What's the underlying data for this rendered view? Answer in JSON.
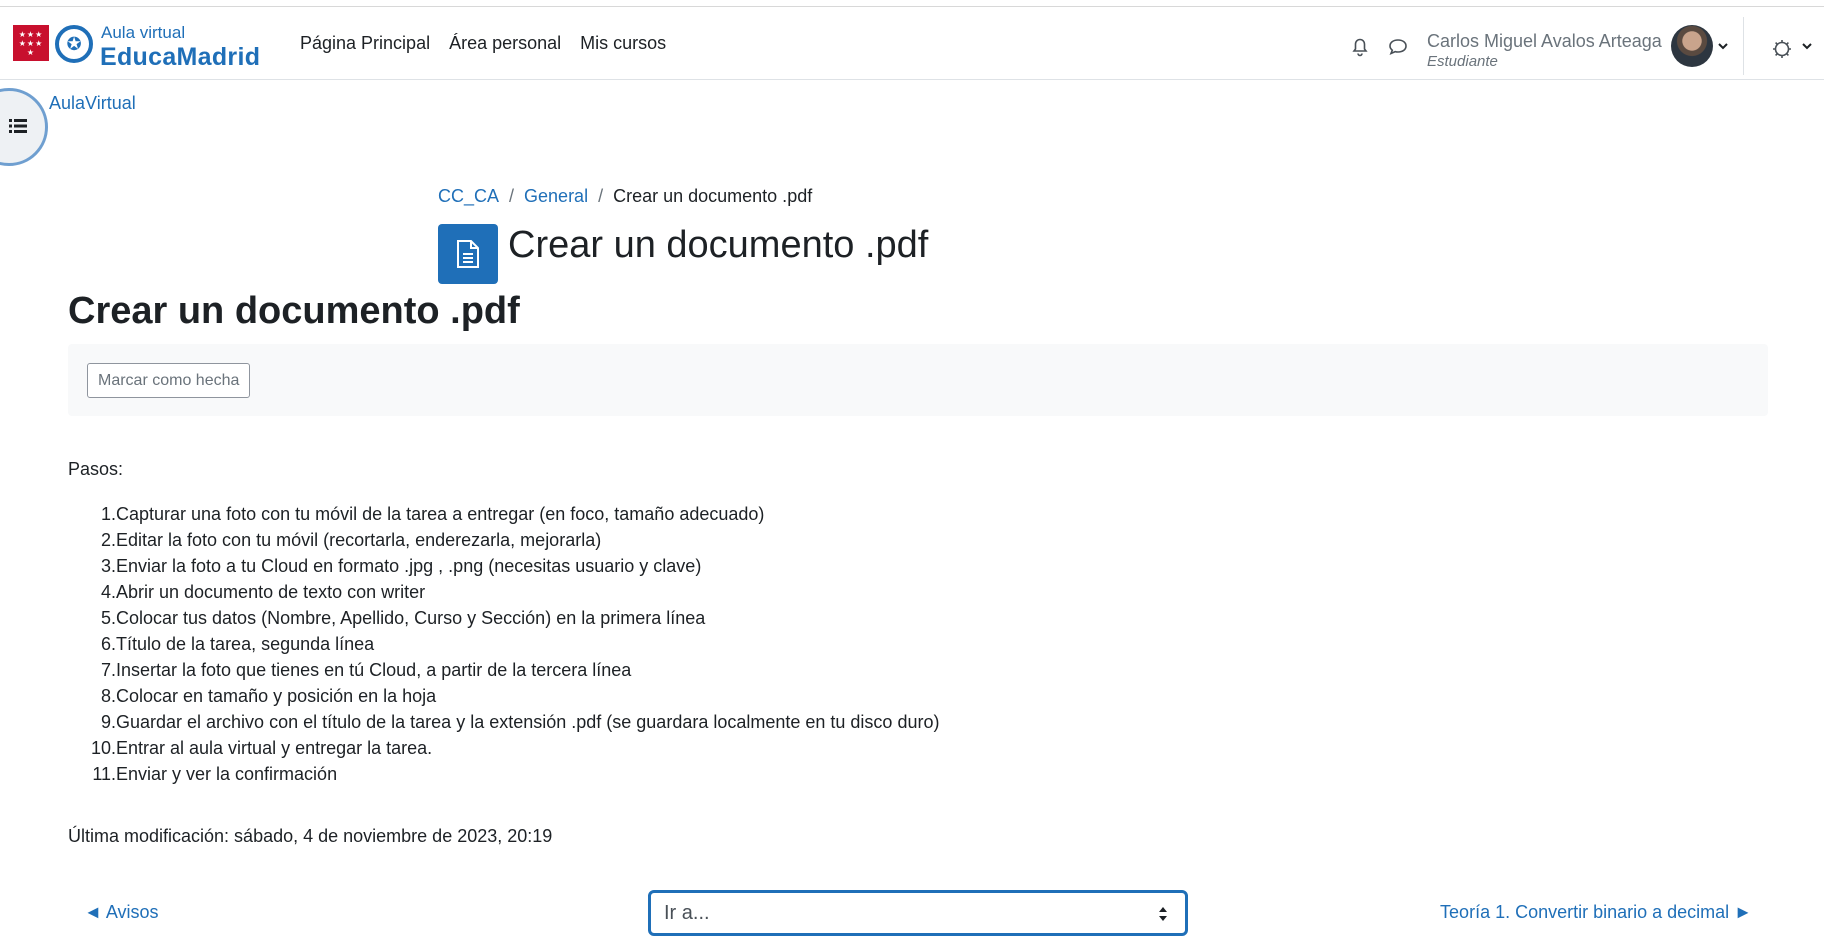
{
  "header": {
    "logo_small": "Aula virtual",
    "logo_big": "EducaMadrid",
    "nav": [
      "Página Principal",
      "Área personal",
      "Mis cursos"
    ],
    "user_name": "Carlos Miguel Avalos Arteaga",
    "user_role": "Estudiante"
  },
  "drawer": {
    "label": "AulaVirtual"
  },
  "breadcrumb": {
    "course": "CC_CA",
    "section": "General",
    "current": "Crear un documento .pdf"
  },
  "page": {
    "title": "Crear un documento .pdf",
    "main_title": "Crear un documento .pdf",
    "mark_done_label": "Marcar como hecha",
    "intro": "Pasos:",
    "steps": [
      {
        "n": "1.",
        "text": "Capturar una foto con tu móvil  de la tarea a entregar (en foco, tamaño adecuado)"
      },
      {
        "n": "2.",
        "text": "Editar la foto con tu móvil (recortarla, enderezarla, mejorarla)"
      },
      {
        "n": "3.",
        "text": "Enviar la foto a tu Cloud en formato .jpg , .png (necesitas usuario y clave)"
      },
      {
        "n": "4.",
        "text": "Abrir un documento de texto con writer"
      },
      {
        "n": "5.",
        "text": "Colocar tus datos (Nombre, Apellido, Curso y Sección) en la primera línea"
      },
      {
        "n": "6.",
        "text": "Título de la tarea, segunda línea"
      },
      {
        "n": "7.",
        "text": "Insertar la foto que tienes en tú Cloud, a partir de la tercera línea"
      },
      {
        "n": "8.",
        "text": "Colocar en tamaño y posición en la hoja"
      },
      {
        "n": "9.",
        "text": "Guardar el archivo con el título de la tarea y la extensión .pdf (se guardara localmente en tu disco duro)"
      },
      {
        "n": "10.",
        "text": "Entrar al aula virtual y entregar la tarea."
      },
      {
        "n": "11.",
        "text": "Enviar y ver la confirmación"
      }
    ],
    "last_modified": "Última modificación: sábado, 4 de noviembre de 2023, 20:19"
  },
  "footer_nav": {
    "prev": "◄ Avisos",
    "jump_selected": "Ir a...",
    "next": "Teoría 1. Convertir binario a decimal ►"
  },
  "colors": {
    "accent": "#1f6fb8",
    "flag": "#c8102e"
  }
}
